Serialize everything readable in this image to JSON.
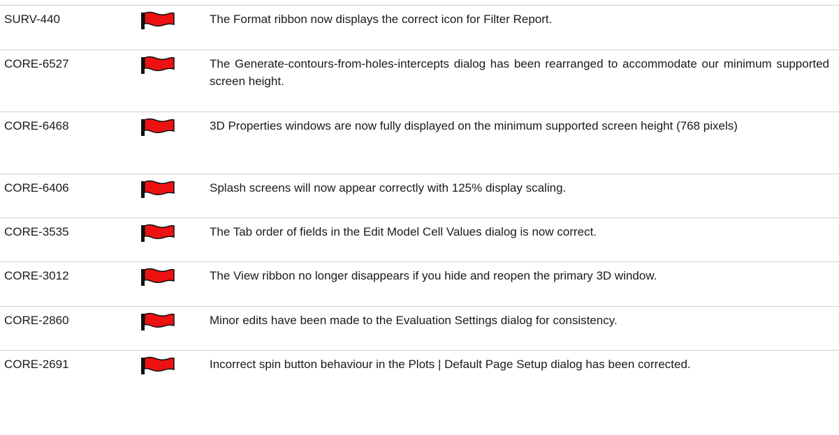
{
  "rows": [
    {
      "id": "SURV-440",
      "flag_icon": "red-flag-icon",
      "description": "The Format ribbon now displays the correct icon for Filter Report."
    },
    {
      "id": "CORE-6527",
      "flag_icon": "red-flag-icon",
      "description": "The Generate-contours-from-holes-intercepts dialog has been rearranged to accommodate our minimum supported screen height."
    },
    {
      "id": "CORE-6468",
      "flag_icon": "red-flag-icon",
      "description": "3D Properties windows are now fully displayed on the minimum supported screen height (768 pixels)"
    },
    {
      "id": "CORE-6406",
      "flag_icon": "red-flag-icon",
      "description": "Splash screens will now appear correctly with 125% display scaling."
    },
    {
      "id": "CORE-3535",
      "flag_icon": "red-flag-icon",
      "description": "The Tab order of fields in the Edit Model Cell Values dialog is now correct."
    },
    {
      "id": "CORE-3012",
      "flag_icon": "red-flag-icon",
      "description": "The View ribbon no longer disappears if you hide and reopen the primary 3D window."
    },
    {
      "id": "CORE-2860",
      "flag_icon": "red-flag-icon",
      "description": "Minor edits have been made to the Evaluation Settings dialog for consistency."
    },
    {
      "id": "CORE-2691",
      "flag_icon": "red-flag-icon",
      "description": "Incorrect spin button behaviour in the Plots | Default Page Setup dialog has been corrected."
    }
  ],
  "colors": {
    "flag_red": "#ee1111",
    "flag_outline": "#111111",
    "divider": "#cfcfcf"
  }
}
